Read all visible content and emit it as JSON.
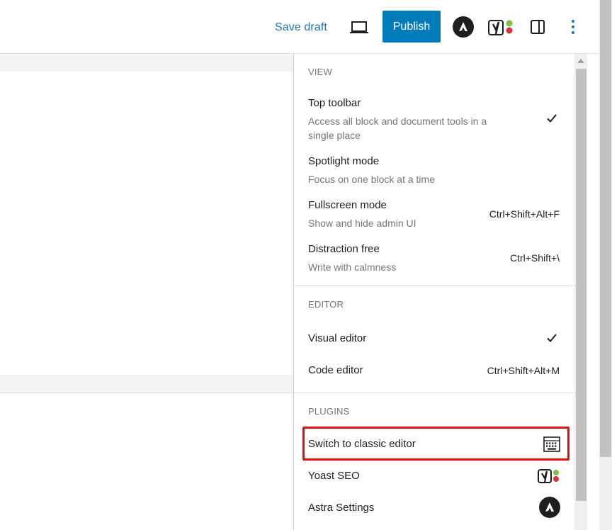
{
  "toolbar": {
    "save_draft": "Save draft",
    "publish": "Publish",
    "preview_icon": "laptop-icon",
    "astra_icon": "astra-logo-icon",
    "yoast_icon": "yoast-icon",
    "settings_icon": "sidebar-toggle-icon",
    "options_icon": "vertical-ellipsis-icon",
    "accent": "#007cba",
    "link_color": "#2271b1"
  },
  "menu": {
    "view": {
      "title": "VIEW",
      "items": [
        {
          "label": "Top toolbar",
          "description": "Access all block and document tools in a single place",
          "checked": true,
          "shortcut": ""
        },
        {
          "label": "Spotlight mode",
          "description": "Focus on one block at a time",
          "checked": false,
          "shortcut": ""
        },
        {
          "label": "Fullscreen mode",
          "description": "Show and hide admin UI",
          "checked": false,
          "shortcut": "Ctrl+Shift+Alt+F"
        },
        {
          "label": "Distraction free",
          "description": "Write with calmness",
          "checked": false,
          "shortcut": "Ctrl+Shift+\\"
        }
      ]
    },
    "editor": {
      "title": "EDITOR",
      "items": [
        {
          "label": "Visual editor",
          "checked": true,
          "shortcut": ""
        },
        {
          "label": "Code editor",
          "checked": false,
          "shortcut": "Ctrl+Shift+Alt+M"
        }
      ]
    },
    "plugins": {
      "title": "PLUGINS",
      "items": [
        {
          "label": "Switch to classic editor",
          "icon": "keyboard-icon",
          "highlighted": true
        },
        {
          "label": "Yoast SEO",
          "icon": "yoast-icon"
        },
        {
          "label": "Astra Settings",
          "icon": "astra-logo-icon"
        }
      ]
    }
  },
  "highlight_color": "#e01010"
}
